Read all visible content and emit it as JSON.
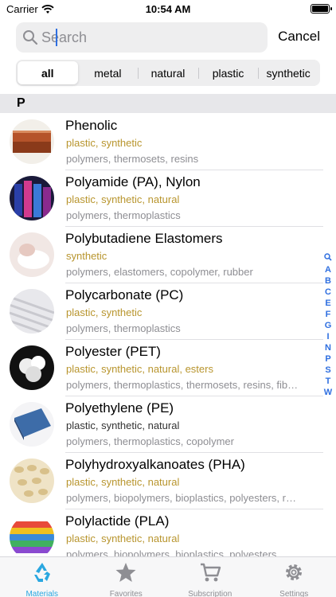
{
  "status": {
    "carrier": "Carrier",
    "time": "10:54 AM"
  },
  "search": {
    "placeholder": "Search",
    "cancel_label": "Cancel"
  },
  "filters": [
    {
      "label": "all",
      "active": true
    },
    {
      "label": "metal",
      "active": false
    },
    {
      "label": "natural",
      "active": false
    },
    {
      "label": "plastic",
      "active": false
    },
    {
      "label": "synthetic",
      "active": false
    }
  ],
  "section_letter": "P",
  "materials": [
    {
      "name": "Phenolic",
      "tags": "plastic, synthetic",
      "categories": "polymers, thermosets, resins",
      "tags_style": "gold",
      "thumb_color": "#b5532a"
    },
    {
      "name": "Polyamide (PA), Nylon",
      "tags": "plastic, synthetic, natural",
      "categories": "polymers, thermoplastics",
      "tags_style": "gold",
      "thumb_color": "#2a3fa8"
    },
    {
      "name": "Polybutadiene Elastomers",
      "tags": "synthetic",
      "categories": "polymers, elastomers, copolymer, rubber",
      "tags_style": "gold",
      "thumb_color": "#f1e7e4"
    },
    {
      "name": "Polycarbonate (PC)",
      "tags": "plastic, synthetic",
      "categories": "polymers, thermoplastics",
      "tags_style": "gold",
      "thumb_color": "#c9c9cf"
    },
    {
      "name": "Polyester (PET)",
      "tags": "plastic, synthetic, natural, esters",
      "categories": "polymers, thermoplastics, thermosets, resins, fibers",
      "tags_style": "gold",
      "thumb_color": "#eeeeee"
    },
    {
      "name": "Polyethylene (PE)",
      "tags": "plastic, synthetic, natural",
      "categories": "polymers, thermoplastics, copolymer",
      "tags_style": "plain",
      "thumb_color": "#3d6ca8"
    },
    {
      "name": "Polyhydroxyalkanoates (PHA)",
      "tags": "plastic, synthetic, natural",
      "categories": "polymers, biopolymers, bioplastics, polyesters, resins",
      "tags_style": "gold",
      "thumb_color": "#d8c08a"
    },
    {
      "name": "Polylactide (PLA)",
      "tags": "plastic, synthetic, natural",
      "categories": "polymers, biopolymers, bioplastics, polyesters",
      "tags_style": "gold",
      "thumb_color": "#3b8ad8"
    }
  ],
  "index": [
    "search-icon",
    "A",
    "B",
    "C",
    "E",
    "F",
    "G",
    "I",
    "N",
    "P",
    "S",
    "T",
    "W"
  ],
  "tabs": [
    {
      "label": "Materials",
      "icon": "recycle-icon",
      "active": true
    },
    {
      "label": "Favorites",
      "icon": "star-icon",
      "active": false
    },
    {
      "label": "Subscription",
      "icon": "cart-icon",
      "active": false
    },
    {
      "label": "Settings",
      "icon": "gear-icon",
      "active": false
    }
  ],
  "colors": {
    "accent": "#2aa7e0",
    "tag_gold": "#b8952e",
    "index_blue": "#2f6fe0"
  }
}
